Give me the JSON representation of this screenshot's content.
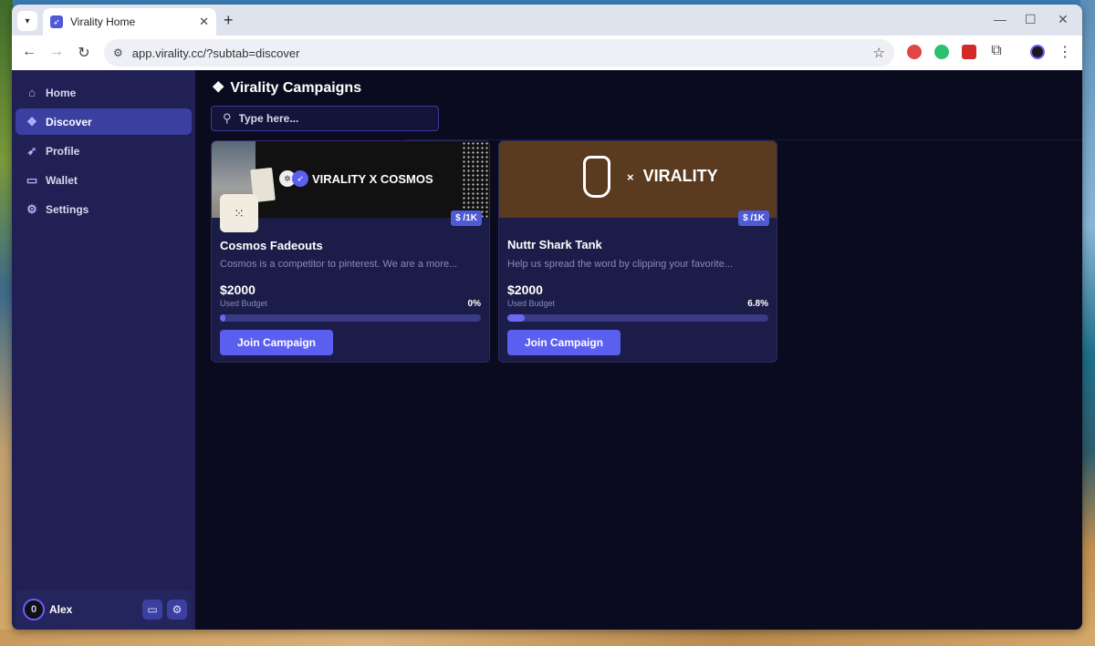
{
  "browser": {
    "tab_title": "Virality Home",
    "url": "app.virality.cc/?subtab=discover"
  },
  "sidebar": {
    "items": [
      {
        "label": "Home",
        "icon": "house-icon"
      },
      {
        "label": "Discover",
        "icon": "compass-icon",
        "active": true
      },
      {
        "label": "Profile",
        "icon": "rocket-icon"
      },
      {
        "label": "Wallet",
        "icon": "wallet-icon"
      },
      {
        "label": "Settings",
        "icon": "gear-icon"
      }
    ],
    "user_name": "Alex",
    "avatar_initial": "0"
  },
  "page": {
    "title": "Virality Campaigns",
    "search_placeholder": "Type here..."
  },
  "campaigns": [
    {
      "banner_text": "VIRALITY X COSMOS",
      "badge": "$ /1K",
      "title": "Cosmos Fadeouts",
      "description": "Cosmos is a competitor to pinterest. We are a more...",
      "budget": "$2000",
      "budget_label": "Used Budget",
      "used_pct_label": "0%",
      "used_fraction": 0.0,
      "button": "Join Campaign"
    },
    {
      "banner_text": "VIRALITY",
      "banner_prefix": "×",
      "badge": "$ /1K",
      "title": "Nuttr Shark Tank",
      "description": "Help us spread the word by clipping your favorite...",
      "budget": "$2000",
      "budget_label": "Used Budget",
      "used_pct_label": "6.8%",
      "used_fraction": 0.068,
      "button": "Join Campaign"
    }
  ],
  "colors": {
    "accent": "#5b5ff0",
    "sidebar_bg": "#202054",
    "main_bg": "#0b0b1f",
    "card_bg": "#1c1c48"
  }
}
